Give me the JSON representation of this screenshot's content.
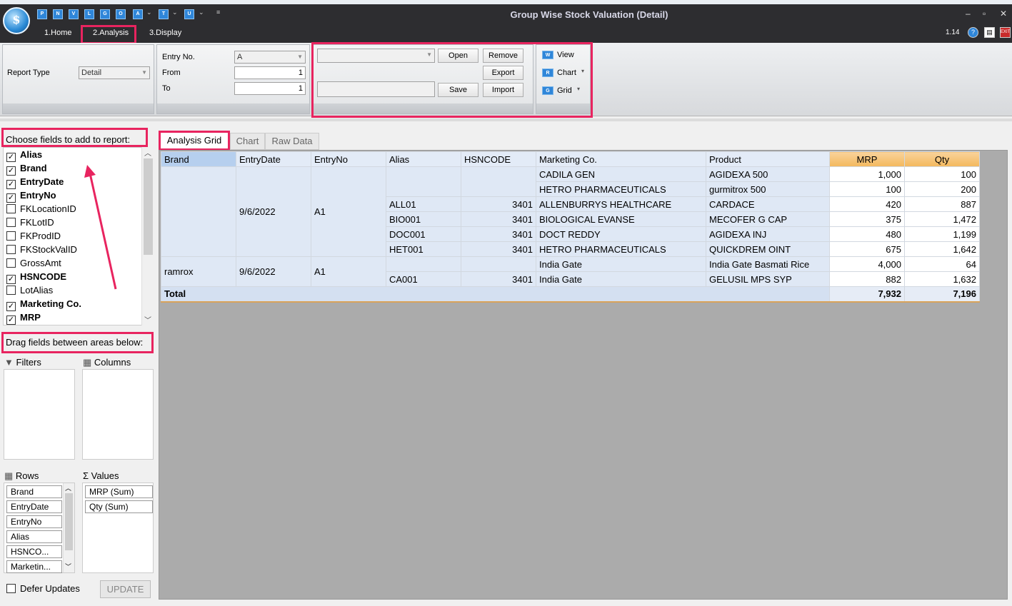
{
  "window": {
    "title": "Group Wise Stock Valuation (Detail)",
    "version": "1.14",
    "quick_access": [
      "P",
      "N",
      "V",
      "L",
      "G",
      "O",
      "A",
      "T",
      "U"
    ]
  },
  "menu": {
    "tabs": [
      "1.Home",
      "2.Analysis",
      "3.Display"
    ]
  },
  "ribbon": {
    "report_type_label": "Report Type",
    "report_type_value": "Detail",
    "entry_no_label": "Entry No.",
    "entry_no_value": "A",
    "from_label": "From",
    "from_value": "1",
    "to_label": "To",
    "to_value": "1",
    "open": "Open",
    "remove": "Remove",
    "export": "Export",
    "save": "Save",
    "import": "Import",
    "view": "View",
    "chart": "Chart",
    "grid": "Grid"
  },
  "field_list": {
    "header": "Choose fields to add to report:",
    "fields": [
      {
        "name": "Alias",
        "checked": true
      },
      {
        "name": "Brand",
        "checked": true
      },
      {
        "name": "EntryDate",
        "checked": true
      },
      {
        "name": "EntryNo",
        "checked": true
      },
      {
        "name": "FKLocationID",
        "checked": false
      },
      {
        "name": "FKLotID",
        "checked": false
      },
      {
        "name": "FKProdID",
        "checked": false
      },
      {
        "name": "FKStockValID",
        "checked": false
      },
      {
        "name": "GrossAmt",
        "checked": false
      },
      {
        "name": "HSNCODE",
        "checked": true
      },
      {
        "name": "LotAlias",
        "checked": false
      },
      {
        "name": "Marketing Co.",
        "checked": true
      },
      {
        "name": "MRP",
        "checked": true
      }
    ]
  },
  "areas": {
    "header": "Drag fields between areas below:",
    "filters": "Filters",
    "columns": "Columns",
    "rows": "Rows",
    "values": "Values",
    "row_items": [
      "Brand",
      "EntryDate",
      "EntryNo",
      "Alias",
      "HSNCO...",
      "Marketin..."
    ],
    "value_items": [
      "MRP (Sum)",
      "Qty (Sum)"
    ],
    "defer_updates": "Defer Updates",
    "update": "UPDATE"
  },
  "tabs": [
    "Analysis Grid",
    "Chart",
    "Raw Data"
  ],
  "grid": {
    "headers": [
      "Brand",
      "EntryDate",
      "EntryNo",
      "Alias",
      "HSNCODE",
      "Marketing Co.",
      "Product",
      "MRP",
      "Qty"
    ],
    "group1": {
      "brand": "",
      "date": "9/6/2022",
      "entry": "A1"
    },
    "group2": {
      "brand": "ramrox",
      "date": "9/6/2022",
      "entry": "A1"
    },
    "rows": [
      {
        "alias": "",
        "hsn": "",
        "mkt": "CADILA GEN",
        "product": "AGIDEXA 500",
        "mrp": "1,000",
        "qty": "100"
      },
      {
        "alias": "",
        "hsn": "",
        "mkt": "HETRO PHARMACEUTICALS",
        "product": "gurmitrox 500",
        "mrp": "100",
        "qty": "200"
      },
      {
        "alias": "ALL01",
        "hsn": "3401",
        "mkt": "ALLENBURRYS HEALTHCARE",
        "product": "CARDACE",
        "mrp": "420",
        "qty": "887"
      },
      {
        "alias": "BIO001",
        "hsn": "3401",
        "mkt": "BIOLOGICAL EVANSE",
        "product": "MECOFER G CAP",
        "mrp": "375",
        "qty": "1,472"
      },
      {
        "alias": "DOC001",
        "hsn": "3401",
        "mkt": "DOCT REDDY",
        "product": "AGIDEXA INJ",
        "mrp": "480",
        "qty": "1,199"
      },
      {
        "alias": "HET001",
        "hsn": "3401",
        "mkt": "HETRO PHARMACEUTICALS",
        "product": "QUICKDREM OINT",
        "mrp": "675",
        "qty": "1,642"
      },
      {
        "alias": "",
        "hsn": "",
        "mkt": "India Gate",
        "product": "India Gate Basmati Rice",
        "mrp": "4,000",
        "qty": "64"
      },
      {
        "alias": "CA001",
        "hsn": "3401",
        "mkt": "India Gate",
        "product": "GELUSIL MPS SYP",
        "mrp": "882",
        "qty": "1,632"
      }
    ],
    "total_label": "Total",
    "total_mrp": "7,932",
    "total_qty": "7,196"
  }
}
